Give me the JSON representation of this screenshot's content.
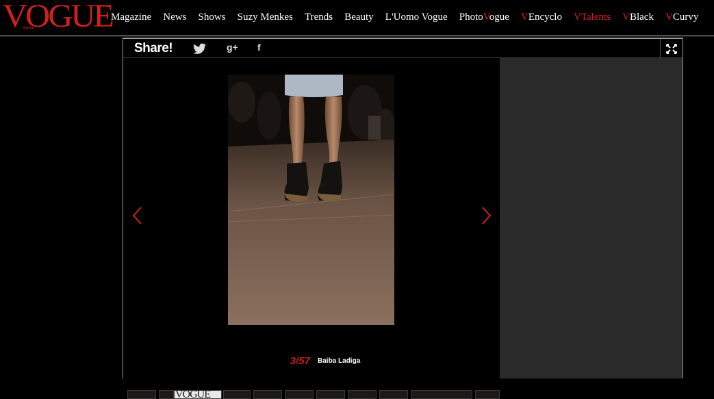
{
  "brand": {
    "logo_text": "VOGUE",
    "logo_prefix": "Italia",
    "accent_color": "#d2201f"
  },
  "nav": {
    "items": [
      {
        "label": "Magazine"
      },
      {
        "label": "News"
      },
      {
        "label": "Shows"
      },
      {
        "label": "Suzy Menkes"
      },
      {
        "label": "Trends"
      },
      {
        "label": "Beauty"
      },
      {
        "label": "L'Uomo Vogue"
      },
      {
        "pre": "Photo",
        "accent": "V",
        "label": "ogue"
      },
      {
        "accent": "V",
        "label": "Encyclo"
      },
      {
        "accent": "V",
        "label": "Talents",
        "active": true
      },
      {
        "accent": "V",
        "label": "Black"
      },
      {
        "accent": "V",
        "label": "Curvy"
      }
    ]
  },
  "share": {
    "label": "Share!",
    "icons": [
      "twitter-icon",
      "google-plus-icon",
      "facebook-icon"
    ],
    "gplus_glyph": "g+",
    "facebook_glyph": "f",
    "fullscreen_icon": "fullscreen-icon"
  },
  "gallery": {
    "counter": "3/57",
    "designer": "Baiba Ladiga",
    "prev_icon": "chevron-left-icon",
    "next_icon": "chevron-right-icon",
    "thumbnail_logo": "VOGUE"
  }
}
